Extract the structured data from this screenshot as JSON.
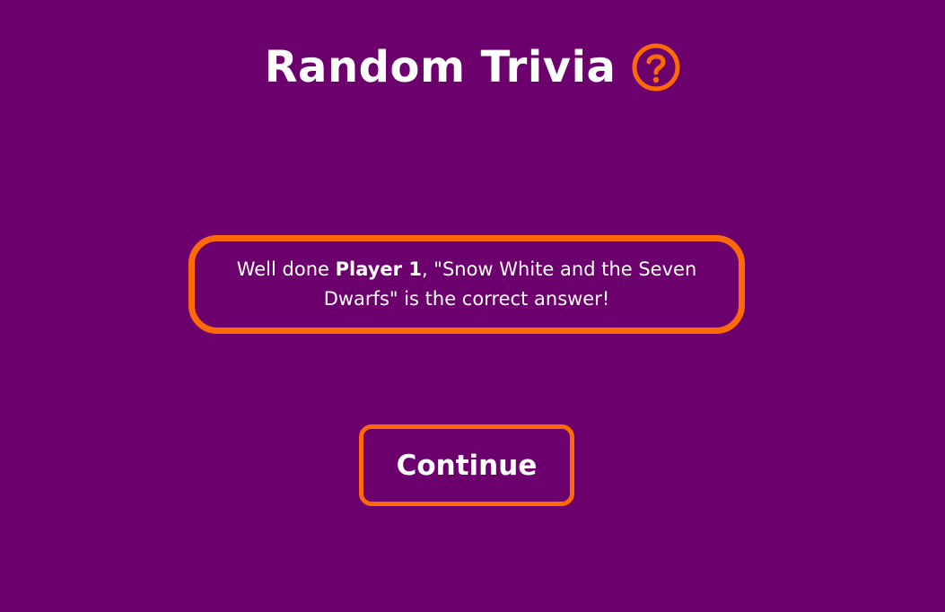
{
  "header": {
    "title": "Random Trivia",
    "help_icon": "question-circle-icon"
  },
  "result": {
    "prefix": "Well done ",
    "player_name": "Player 1",
    "suffix": ", \"Snow White and the Seven Dwarfs\" is the correct answer!"
  },
  "actions": {
    "continue_label": "Continue"
  },
  "colors": {
    "background": "#6c006c",
    "accent": "#ff6a08",
    "text": "#ffffff"
  }
}
